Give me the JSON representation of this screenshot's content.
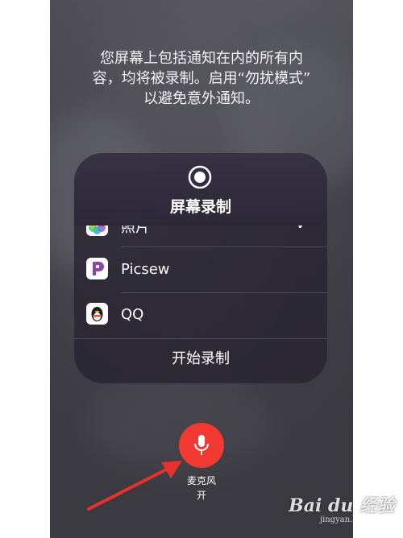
{
  "notice": {
    "line1": "您屏幕上包括通知在内的所有内",
    "line2": "容，均将被录制。启用“勿扰模式”",
    "line3": "以避免意外通知。"
  },
  "panel": {
    "title": "屏幕录制",
    "apps": [
      {
        "label": "照片",
        "icon": "photos-app-icon",
        "selected": true
      },
      {
        "label": "Picsew",
        "icon": "picsew-app-icon",
        "selected": false
      },
      {
        "label": "QQ",
        "icon": "qq-app-icon",
        "selected": false
      }
    ],
    "check_mark": "✓",
    "start_label": "开始录制"
  },
  "microphone": {
    "label": "麦克风",
    "state": "开",
    "color": "#f23a33"
  },
  "annotation": {
    "arrow_color": "#e8322b"
  },
  "watermark": {
    "text": "Bai du 经验",
    "sub": "jingyan.baidu.com"
  }
}
